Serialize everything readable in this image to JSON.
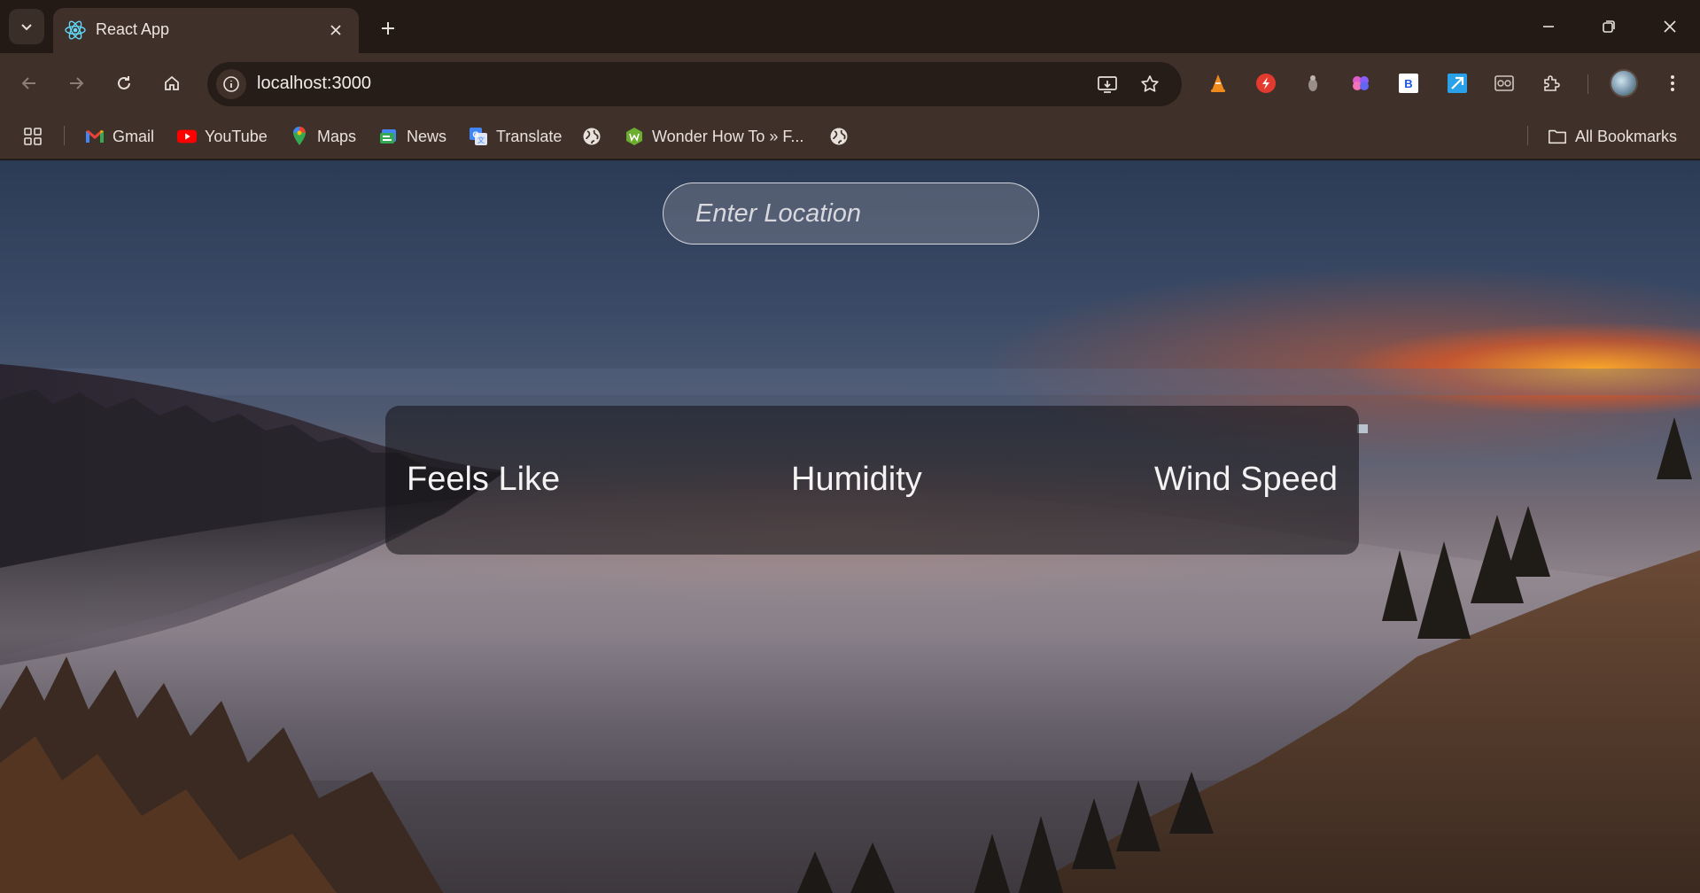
{
  "browser": {
    "tab_title": "React App",
    "url": "localhost:3000"
  },
  "bookmarks": {
    "items": [
      "Gmail",
      "YouTube",
      "Maps",
      "News",
      "Translate",
      "Wonder How To » F..."
    ],
    "all_bookmarks": "All Bookmarks"
  },
  "app": {
    "search_placeholder": "Enter Location",
    "stats": {
      "feels_like": "Feels Like",
      "humidity": "Humidity",
      "wind_speed": "Wind Speed"
    }
  },
  "colors": {
    "browser_frame": "#3f3029",
    "tab_strip": "#231a16",
    "card_background": "rgba(22,20,24,0.58)"
  }
}
